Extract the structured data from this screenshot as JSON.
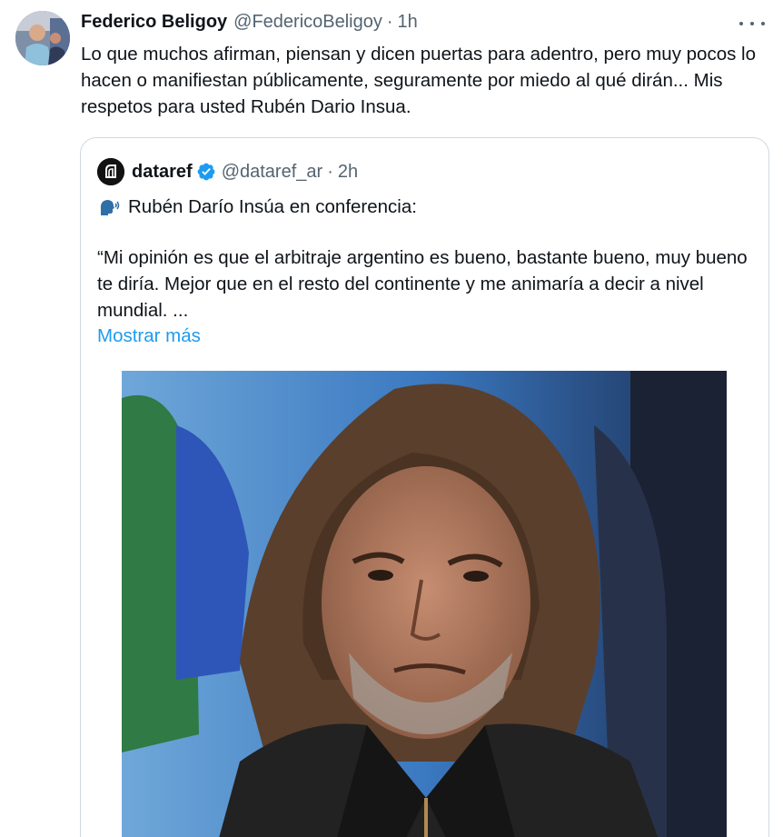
{
  "tweet": {
    "author_name": "Federico Beligoy",
    "author_handle": "@FedericoBeligoy",
    "separator": "·",
    "time": "1h",
    "text": "Lo que muchos afirman, piensan y dicen puertas para adentro, pero muy pocos lo hacen o manifiestan públicamente, seguramente por miedo al qué dirán... Mis respetos para usted Rubén Dario Insua.",
    "avatar_icon": "profile-photo",
    "more_icon": "more-options-icon"
  },
  "quoted": {
    "author_name": "dataref",
    "author_handle": "@dataref_ar",
    "separator": "·",
    "time": "2h",
    "verified_icon": "verified-badge-icon",
    "lead": "Rubén Darío Insúa en conferencia:",
    "lead_icon": "speaking-head-icon",
    "quote": "“Mi opinión es que el arbitraje argentino es bueno, bastante bueno, muy bueno te diría. Mejor que en el resto del continente y me animaría a decir a nivel mundial. ...",
    "show_more": "Mostrar más",
    "media_icon": "photo-of-man-in-leather-jacket"
  },
  "colors": {
    "text": "#0f1419",
    "secondary": "#536471",
    "link": "#1d9bf0",
    "verified": "#1d9bf0",
    "border": "#cfd9de"
  }
}
